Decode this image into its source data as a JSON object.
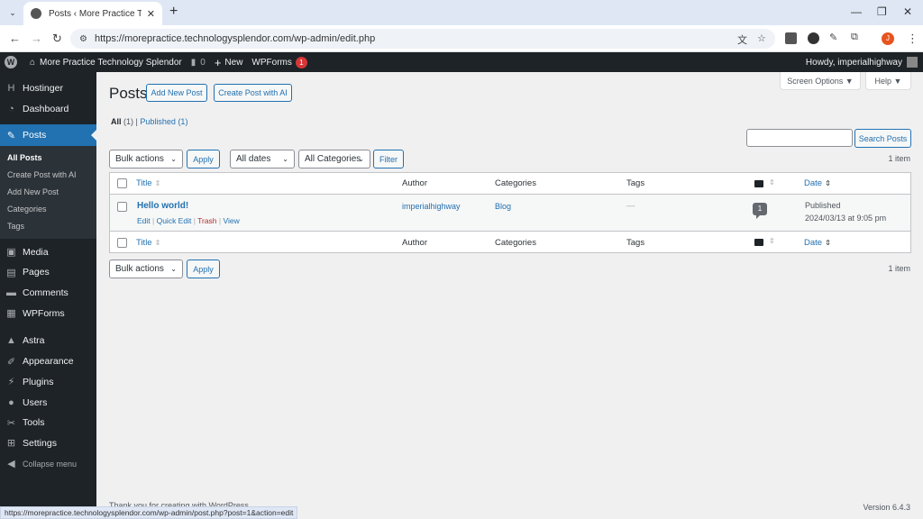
{
  "browser": {
    "tab_title": "Posts ‹ More Practice Technology Splendor",
    "url": "https://morepractice.technologysplendor.com/wp-admin/edit.php",
    "profile_initial": "J",
    "status_url": "https://morepractice.technologysplendor.com/wp-admin/post.php?post=1&action=edit"
  },
  "adminbar": {
    "site_name": "More Practice Technology Splendor",
    "comments_count": "0",
    "new_label": "New",
    "wpforms_label": "WPForms",
    "wpforms_badge": "1",
    "howdy": "Howdy, imperialhighway"
  },
  "sidebar": {
    "items": [
      {
        "label": "Hostinger",
        "icon": "hostinger-icon"
      },
      {
        "label": "Dashboard",
        "icon": "dashboard-icon"
      },
      {
        "label": "Posts",
        "icon": "pin-icon",
        "active": true
      },
      {
        "label": "Media",
        "icon": "media-icon"
      },
      {
        "label": "Pages",
        "icon": "pages-icon"
      },
      {
        "label": "Comments",
        "icon": "comments-icon"
      },
      {
        "label": "WPForms",
        "icon": "wpforms-icon"
      },
      {
        "label": "Astra",
        "icon": "astra-icon"
      },
      {
        "label": "Appearance",
        "icon": "appearance-icon"
      },
      {
        "label": "Plugins",
        "icon": "plugins-icon"
      },
      {
        "label": "Users",
        "icon": "users-icon"
      },
      {
        "label": "Tools",
        "icon": "tools-icon"
      },
      {
        "label": "Settings",
        "icon": "settings-icon"
      },
      {
        "label": "Collapse menu",
        "icon": "collapse-icon"
      }
    ],
    "submenu": [
      "All Posts",
      "Create Post with AI",
      "Add New Post",
      "Categories",
      "Tags"
    ]
  },
  "main": {
    "title": "Posts",
    "add_new": "Add New Post",
    "create_ai": "Create Post with AI",
    "screen_options": "Screen Options ▼",
    "help": "Help ▼",
    "filters": {
      "all": "All",
      "all_count": "(1)",
      "published": "Published",
      "published_count": "(1)"
    },
    "bulk_actions": "Bulk actions",
    "apply": "Apply",
    "all_dates": "All dates",
    "all_categories": "All Categories",
    "filter": "Filter",
    "search_button": "Search Posts",
    "search_value": "",
    "items_count": "1 item",
    "columns": {
      "title": "Title",
      "author": "Author",
      "categories": "Categories",
      "tags": "Tags",
      "date": "Date"
    },
    "posts": [
      {
        "title": "Hello world!",
        "author": "imperialhighway",
        "category": "Blog",
        "tags": "—",
        "comments": "1",
        "status": "Published",
        "date": "2024/03/13 at 9:05 pm",
        "actions": {
          "edit": "Edit",
          "quick_edit": "Quick Edit",
          "trash": "Trash",
          "view": "View"
        }
      }
    ],
    "footer_thanks": "Thank you for creating with WordPress.",
    "version": "Version 6.4.3"
  },
  "colors": {
    "accent": "#2271b1",
    "adminbar": "#1d2327",
    "badge": "#d63638",
    "trash": "#b32d2e"
  }
}
